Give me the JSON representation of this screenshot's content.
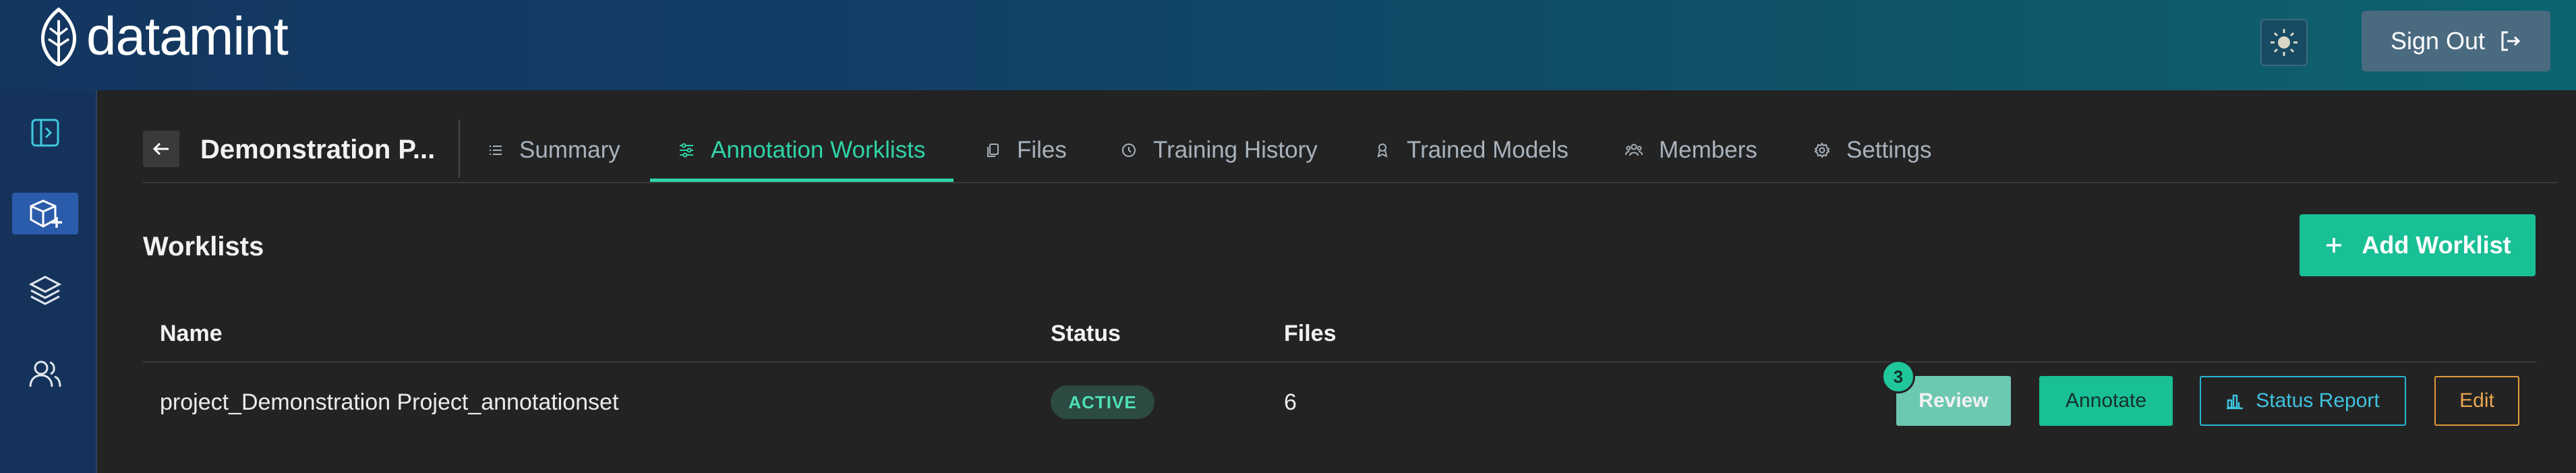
{
  "header": {
    "brand": "datamint",
    "sign_out_label": "Sign Out",
    "icons": {
      "logo": "leaf-icon",
      "theme": "sun-icon",
      "sign_out": "logout-icon"
    }
  },
  "rail": {
    "items": [
      {
        "name": "expand-sidebar",
        "icon": "sidebar-toggle-icon"
      },
      {
        "name": "projects",
        "icon": "cube-plus-icon",
        "active": true
      },
      {
        "name": "datasets",
        "icon": "layers-icon"
      },
      {
        "name": "users",
        "icon": "users-icon"
      }
    ]
  },
  "project": {
    "title": "Demonstration P..."
  },
  "tabs": [
    {
      "label": "Summary",
      "icon": "list-icon",
      "active": false
    },
    {
      "label": "Annotation Worklists",
      "icon": "sliders-icon",
      "active": true
    },
    {
      "label": "Files",
      "icon": "files-icon",
      "active": false
    },
    {
      "label": "Training History",
      "icon": "history-icon",
      "active": false
    },
    {
      "label": "Trained Models",
      "icon": "model-icon",
      "active": false
    },
    {
      "label": "Members",
      "icon": "members-icon",
      "active": false
    },
    {
      "label": "Settings",
      "icon": "gear-icon",
      "active": false
    }
  ],
  "worklists": {
    "title": "Worklists",
    "add_label": "Add Worklist",
    "columns": [
      "Name",
      "Status",
      "Files"
    ],
    "rows": [
      {
        "name": "project_Demonstration Project_annotationset",
        "status": "ACTIVE",
        "files": "6",
        "review_count": "3",
        "actions": {
          "review": "Review",
          "annotate": "Annotate",
          "status_report": "Status Report",
          "edit": "Edit"
        }
      }
    ]
  },
  "colors": {
    "accent": "#19bf95",
    "tab_active": "#2fd3a8",
    "status_report_border": "#27b9d6",
    "edit_border": "#e39a3c"
  }
}
